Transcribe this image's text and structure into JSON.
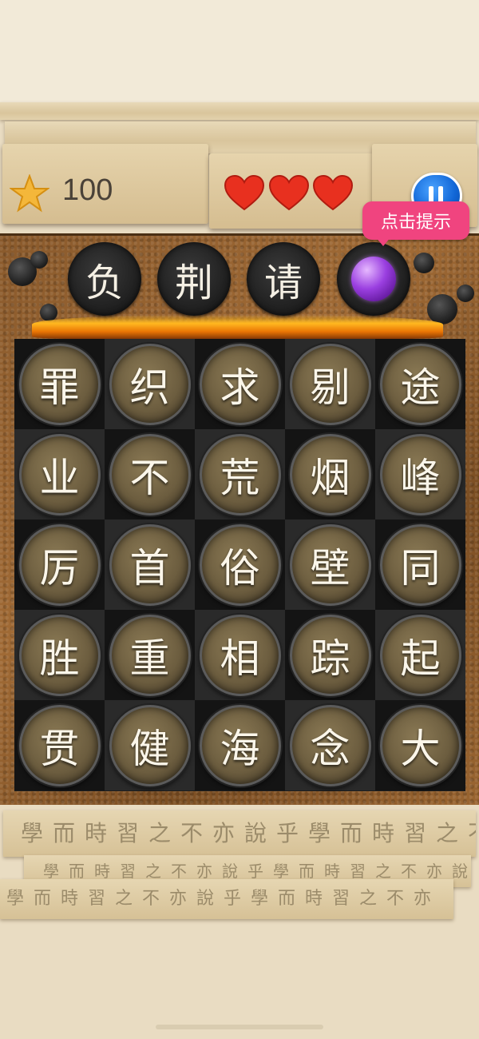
{
  "hud": {
    "score": "100",
    "lives": 3,
    "icons": {
      "star": "star-icon",
      "heart": "heart-icon",
      "pause": "pause-icon"
    }
  },
  "hint": {
    "label": "点击提示"
  },
  "answer_slots": [
    {
      "char": "负"
    },
    {
      "char": "荆"
    },
    {
      "char": "请"
    },
    {
      "char": "",
      "orb": true
    }
  ],
  "board": {
    "rows": [
      [
        "罪",
        "织",
        "求",
        "剔",
        "途"
      ],
      [
        "业",
        "不",
        "荒",
        "烟",
        "峰"
      ],
      [
        "厉",
        "首",
        "俗",
        "壁",
        "同"
      ],
      [
        "胜",
        "重",
        "相",
        "踪",
        "起"
      ],
      [
        "贯",
        "健",
        "海",
        "念",
        "大"
      ]
    ]
  },
  "decoration": {
    "strip1": "學而時習之不亦說乎學而時習之不",
    "strip2": "學而時習之不亦說乎學而時習之不亦說乎",
    "strip3": "學而時習之不亦說乎學而時習之不亦"
  },
  "colors": {
    "hint_bubble": "#f0447f",
    "orb": "#9a3fe0",
    "pause": "#1166d6"
  }
}
